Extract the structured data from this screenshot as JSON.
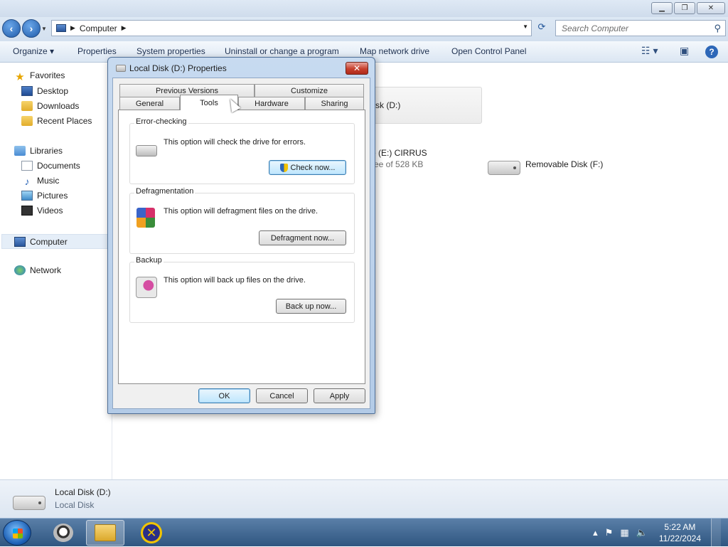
{
  "window": {
    "address_root_icon": "computer-icon",
    "address_path": "Computer",
    "search_placeholder": "Search Computer"
  },
  "toolbar": {
    "organize": "Organize ▾",
    "properties": "Properties",
    "system_properties": "System properties",
    "uninstall": "Uninstall or change a program",
    "map_drive": "Map network drive",
    "control_panel": "Open Control Panel"
  },
  "nav": {
    "favorites": "Favorites",
    "desktop": "Desktop",
    "downloads": "Downloads",
    "recent_places": "Recent Places",
    "libraries": "Libraries",
    "documents": "Documents",
    "music": "Music",
    "pictures": "Pictures",
    "videos": "Videos",
    "computer": "Computer",
    "network": "Network"
  },
  "content": {
    "drive_d_partial": "sk (D:)",
    "drive_e_partial": "e (E:) CIRRUS",
    "drive_e_free_partial": "ree of 528 KB",
    "drive_f": "Removable Disk (F:)"
  },
  "details": {
    "name": "Local Disk (D:)",
    "type": "Local Disk"
  },
  "dialog": {
    "title": "Local Disk (D:) Properties",
    "close": "✕",
    "tabs_row1": [
      "Previous Versions",
      "Customize"
    ],
    "tabs_row2": [
      "General",
      "Tools",
      "Hardware",
      "Sharing"
    ],
    "active_tab": "Tools",
    "error_checking": {
      "title": "Error-checking",
      "text": "This option will check the drive for errors.",
      "button": "Check now..."
    },
    "defrag": {
      "title": "Defragmentation",
      "text": "This option will defragment files on the drive.",
      "button": "Defragment now..."
    },
    "backup": {
      "title": "Backup",
      "text": "This option will back up files on the drive.",
      "button": "Back up now..."
    },
    "ok": "OK",
    "cancel": "Cancel",
    "apply": "Apply"
  },
  "taskbar": {
    "time": "5:22 AM",
    "date": "11/22/2024"
  }
}
